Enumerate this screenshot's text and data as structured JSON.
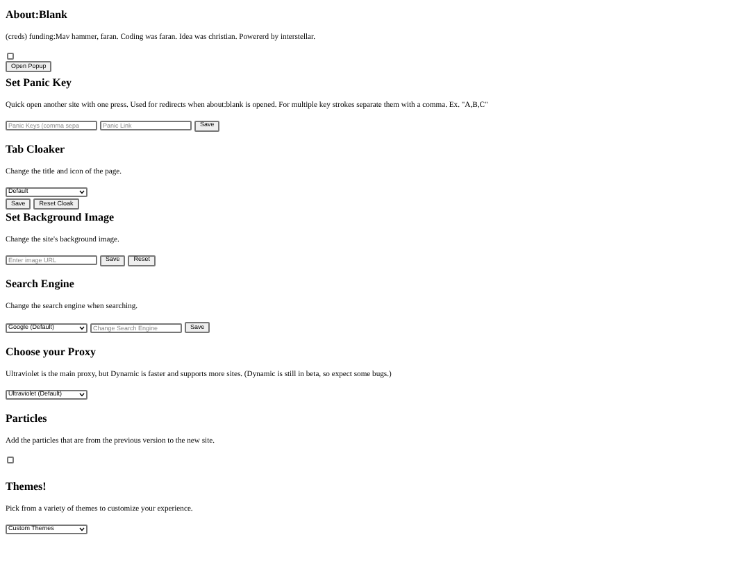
{
  "sections": [
    {
      "title": "About:Blank",
      "description": "(creds) funding:Mav hammer, faran. Coding was faran. Idea was christian. Powererd by interstellar.",
      "rows": [
        [
          {
            "kind": "checkbox",
            "checked": false
          }
        ],
        [
          {
            "kind": "button",
            "label": "Open Popup"
          }
        ]
      ]
    },
    {
      "title": "Set Panic Key",
      "description": "Quick open another site with one press. Used for redirects when about:blank is opened. For multiple key strokes separate them with a comma. Ex. \"A,B,C\"",
      "rows": [
        [
          {
            "kind": "input",
            "placeholder": "Panic Keys (comma sepa"
          },
          {
            "kind": "input",
            "placeholder": "Panic Link"
          },
          {
            "kind": "button",
            "label": "Save"
          }
        ]
      ]
    },
    {
      "title": "Tab Cloaker",
      "description": "Change the title and icon of the page.",
      "rows": [
        [
          {
            "kind": "select",
            "value": "Default"
          }
        ],
        [
          {
            "kind": "button",
            "label": "Save"
          },
          {
            "kind": "button",
            "label": "Reset Cloak"
          }
        ]
      ]
    },
    {
      "title": "Set Background Image",
      "description": "Change the site's background image.",
      "rows": [
        [
          {
            "kind": "input",
            "placeholder": "Enter image URL"
          },
          {
            "kind": "button",
            "label": "Save"
          },
          {
            "kind": "button",
            "label": "Reset"
          }
        ]
      ]
    },
    {
      "title": "Search Engine",
      "description": "Change the search engine when searching.",
      "rows": [
        [
          {
            "kind": "select",
            "value": "Google (Default)"
          },
          {
            "kind": "input",
            "placeholder": "Change Search Engine"
          },
          {
            "kind": "button",
            "label": "Save"
          }
        ]
      ]
    },
    {
      "title": "Choose your Proxy",
      "description": "Ultraviolet is the main proxy, but Dynamic is faster and supports more sites. (Dynamic is still in beta, so expect some bugs.)",
      "rows": [
        [
          {
            "kind": "select",
            "value": "Ultraviolet (Default)"
          }
        ]
      ]
    },
    {
      "title": "Particles",
      "description": "Add the particles that are from the previous version to the new site.",
      "rows": [
        [
          {
            "kind": "checkbox",
            "checked": false
          }
        ]
      ]
    },
    {
      "title": "Themes!",
      "description": "Pick from a variety of themes to customize your experience.",
      "rows": [
        [
          {
            "kind": "select",
            "value": "Custom Themes"
          }
        ]
      ]
    }
  ]
}
